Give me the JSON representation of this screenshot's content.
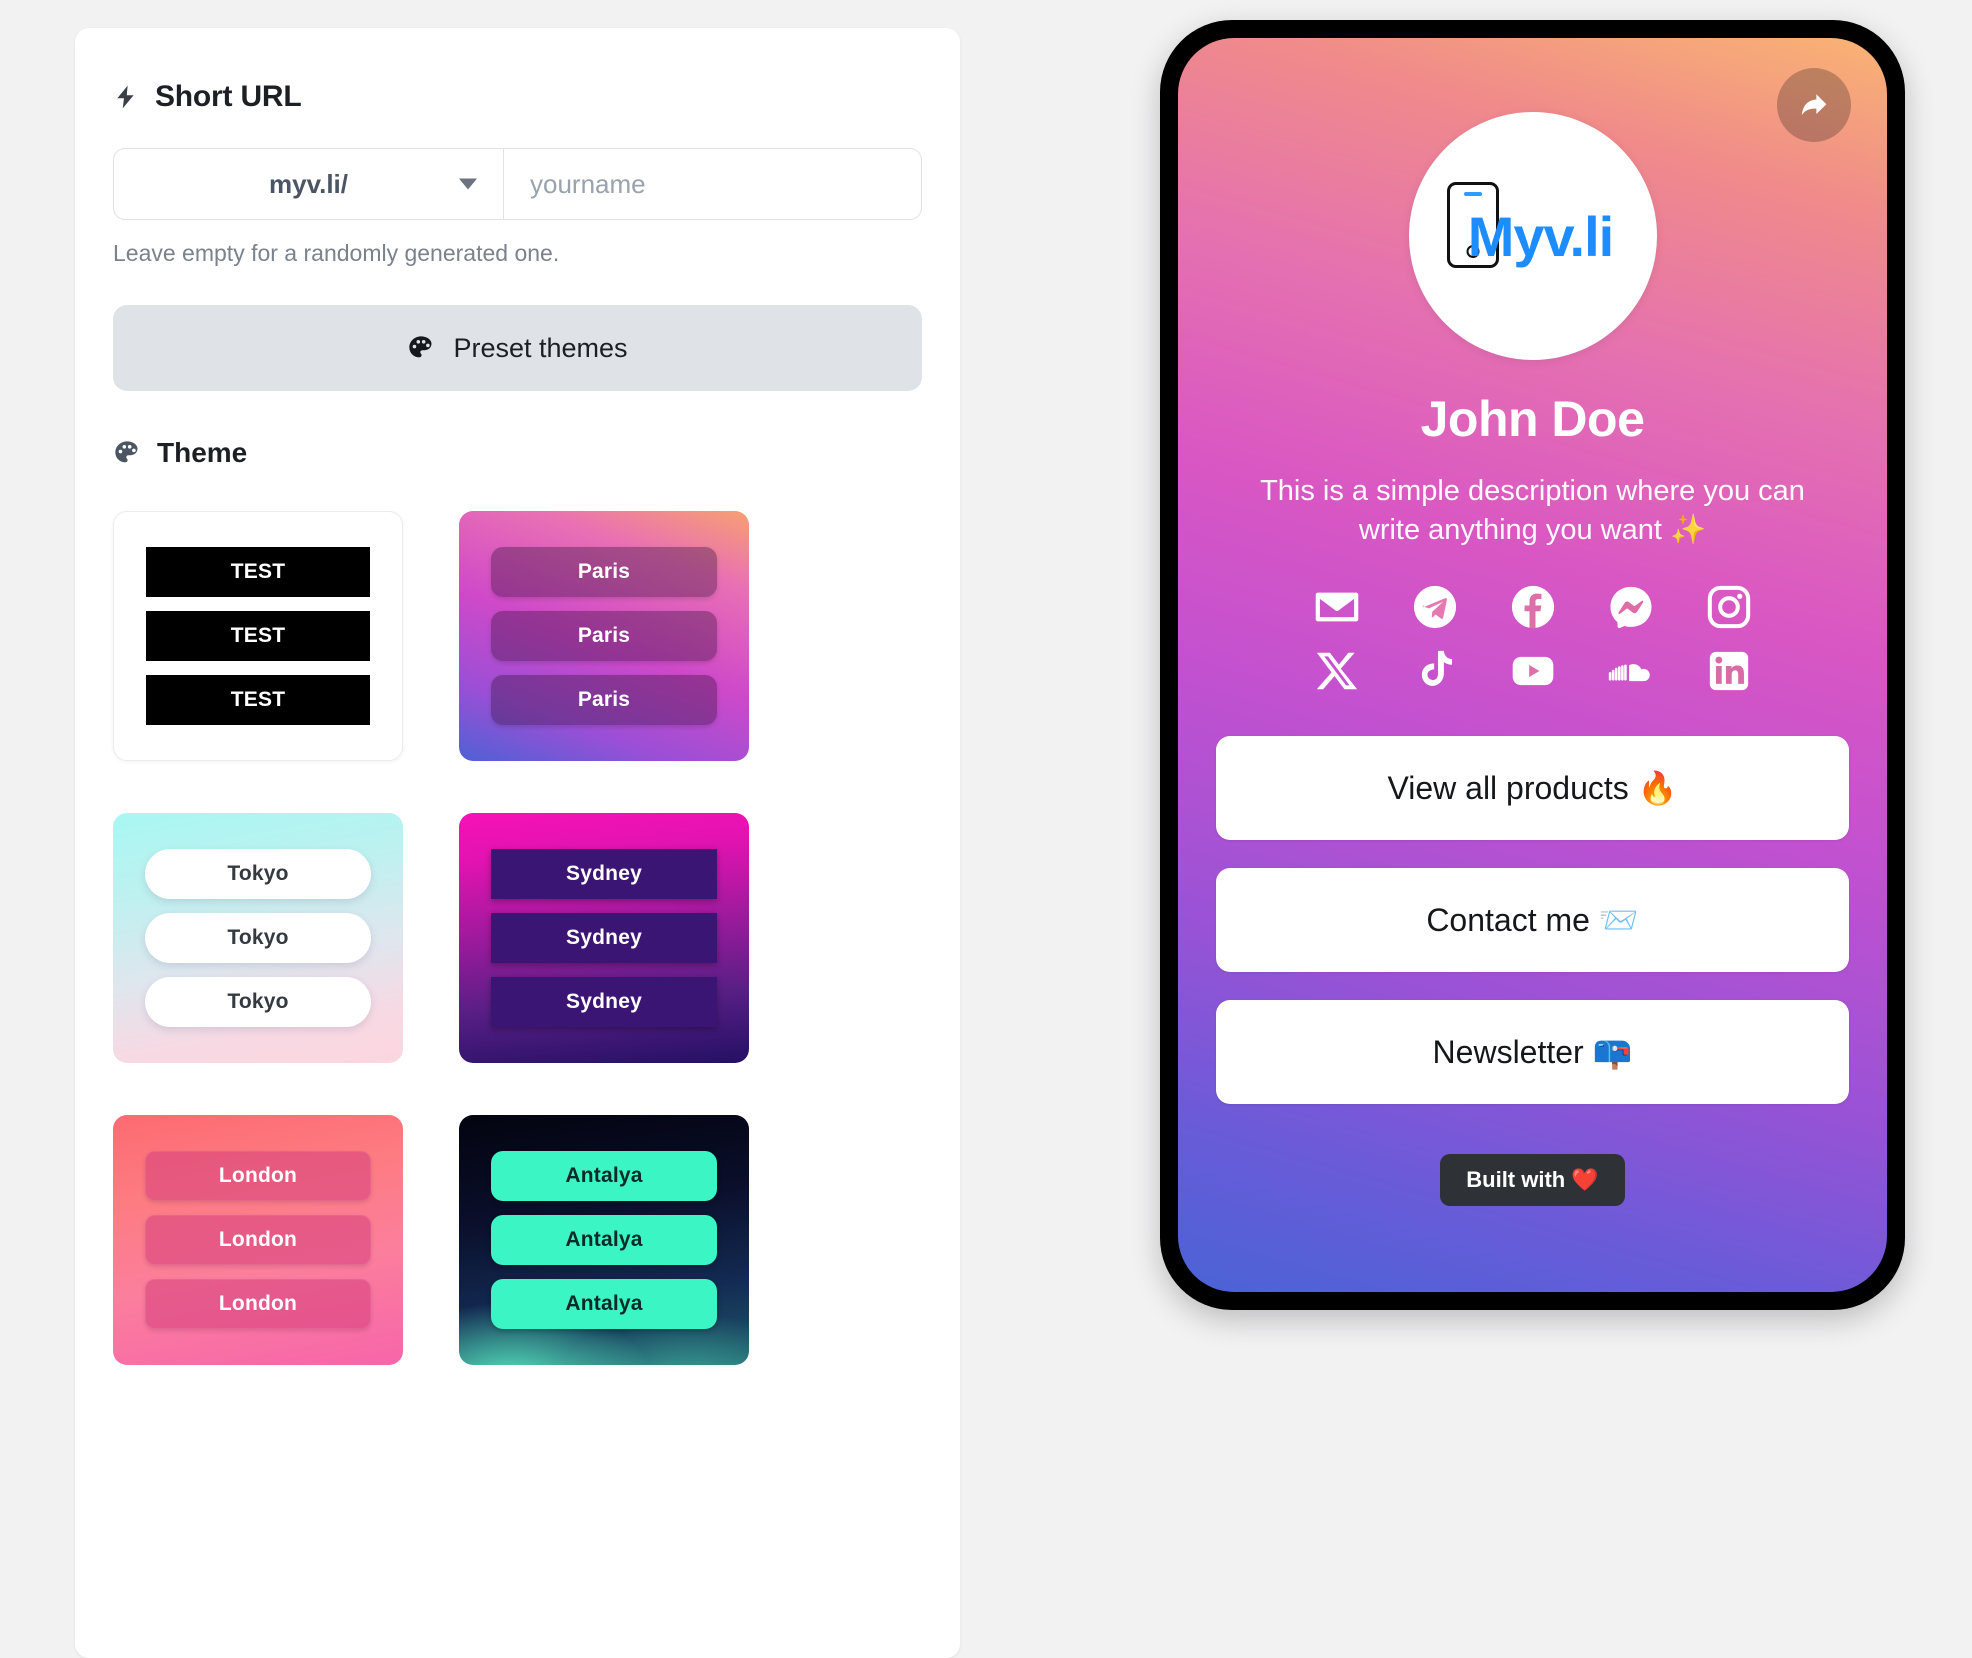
{
  "short_url": {
    "heading": "Short URL",
    "bolt_icon": "bolt-icon",
    "domain_prefix": "myv.li/",
    "slug_value": "",
    "slug_placeholder": "yourname",
    "hint": "Leave empty for a randomly generated one."
  },
  "preset_themes": {
    "label": "Preset themes",
    "icon": "palette-icon"
  },
  "theme": {
    "heading": "Theme",
    "icon": "palette-icon",
    "cards": [
      {
        "id": "test",
        "button_label": "TEST",
        "buttons": [
          "TEST",
          "TEST",
          "TEST"
        ]
      },
      {
        "id": "paris",
        "button_label": "Paris",
        "buttons": [
          "Paris",
          "Paris",
          "Paris"
        ]
      },
      {
        "id": "tokyo",
        "button_label": "Tokyo",
        "buttons": [
          "Tokyo",
          "Tokyo",
          "Tokyo"
        ]
      },
      {
        "id": "sydney",
        "button_label": "Sydney",
        "buttons": [
          "Sydney",
          "Sydney",
          "Sydney"
        ]
      },
      {
        "id": "london",
        "button_label": "London",
        "buttons": [
          "London",
          "London",
          "London"
        ]
      },
      {
        "id": "antalya",
        "button_label": "Antalya",
        "buttons": [
          "Antalya",
          "Antalya",
          "Antalya"
        ]
      }
    ]
  },
  "preview": {
    "share_icon": "share-arrow-icon",
    "logo_text": "Myv.li",
    "logo_glyph": "phone-outline-icon",
    "profile_name": "John Doe",
    "profile_bio": "This is a simple description where you can write anything you want ✨",
    "social_row_1": [
      {
        "name": "email-icon",
        "label": "Email"
      },
      {
        "name": "telegram-icon",
        "label": "Telegram"
      },
      {
        "name": "facebook-icon",
        "label": "Facebook"
      },
      {
        "name": "messenger-icon",
        "label": "Messenger"
      },
      {
        "name": "instagram-icon",
        "label": "Instagram"
      }
    ],
    "social_row_2": [
      {
        "name": "x-twitter-icon",
        "label": "X"
      },
      {
        "name": "tiktok-icon",
        "label": "TikTok"
      },
      {
        "name": "youtube-icon",
        "label": "YouTube"
      },
      {
        "name": "soundcloud-icon",
        "label": "SoundCloud"
      },
      {
        "name": "linkedin-icon",
        "label": "LinkedIn"
      }
    ],
    "links": [
      {
        "label": "View all products 🔥"
      },
      {
        "label": "Contact me 📨"
      },
      {
        "label": "Newsletter 📪"
      }
    ],
    "built_badge": "Built with ❤️"
  },
  "colors": {
    "accent_blue": "#1c8cff",
    "preset_button_bg": "#dfe2e6",
    "text_primary": "#1c1f24",
    "text_muted": "#7b828c",
    "badge_bg": "#2e3136"
  }
}
